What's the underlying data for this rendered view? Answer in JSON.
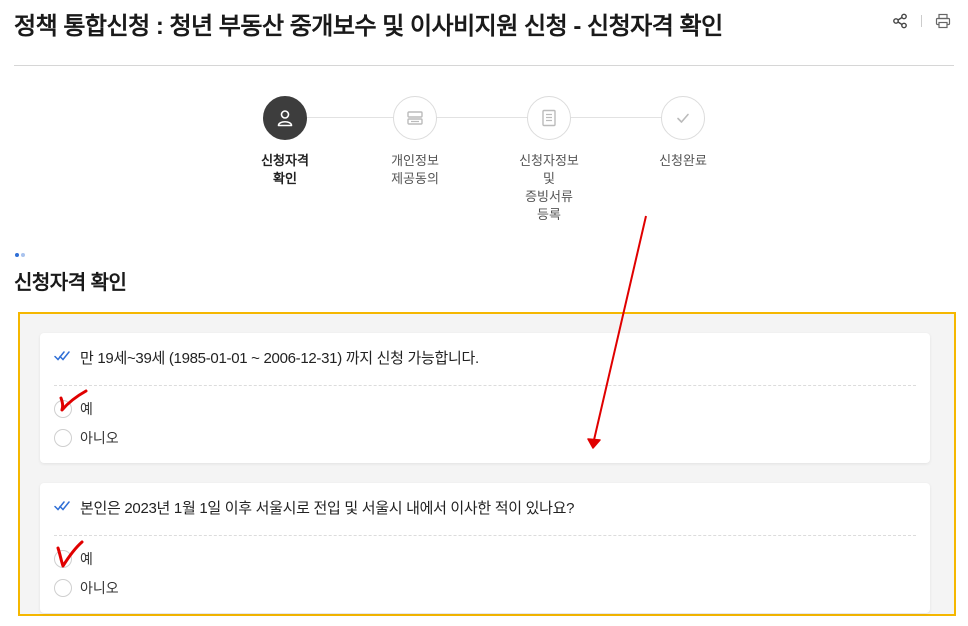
{
  "header": {
    "title": "정책 통합신청 : 청년 부동산 중개보수 및 이사비지원 신청 - 신청자격 확인",
    "share_icon": "share-icon",
    "print_icon": "print-icon"
  },
  "steps": [
    {
      "label": "신청자격\n확인",
      "icon": "person-icon",
      "active": true
    },
    {
      "label": "개인정보\n제공동의",
      "icon": "agreement-icon",
      "active": false
    },
    {
      "label": "신청자정보\n및\n증빙서류\n등록",
      "icon": "document-icon",
      "active": false
    },
    {
      "label": "신청완료",
      "icon": "check-icon",
      "active": false
    }
  ],
  "section": {
    "title": "신청자격 확인"
  },
  "questions": [
    {
      "text": "만 19세~39세 (1985-01-01 ~ 2006-12-31) 까지 신청 가능합니다.",
      "options": [
        "예",
        "아니오"
      ]
    },
    {
      "text": "본인은 2023년 1월 1일 이후 서울시로 전입 및 서울시 내에서 이사한 적이 있나요?",
      "options": [
        "예",
        "아니오"
      ]
    }
  ],
  "colors": {
    "highlight_border": "#f5b700",
    "annotation_red": "#e00000",
    "active_step": "#3d3d3d",
    "check_blue": "#2f6fd6"
  }
}
